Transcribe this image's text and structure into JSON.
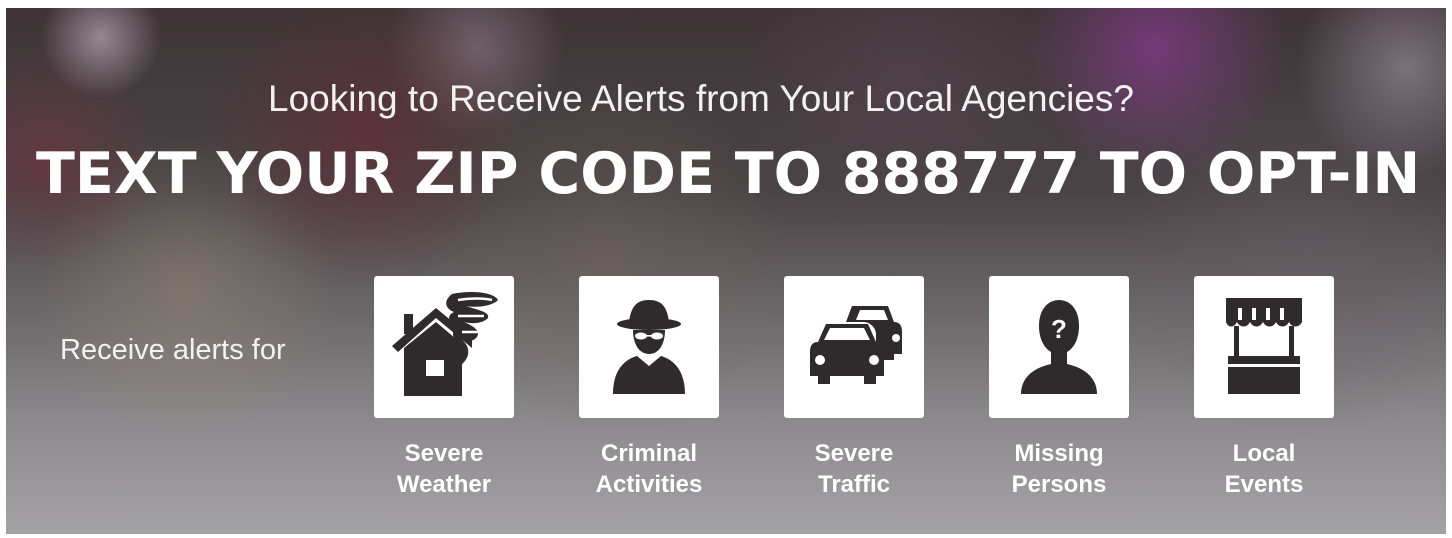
{
  "banner": {
    "subtitle": "Looking to Receive Alerts from Your Local Agencies?",
    "headline": "TEXT YOUR ZIP CODE TO 888777 TO OPT-IN",
    "receive_label": "Receive alerts for"
  },
  "alerts": [
    {
      "icon": "tornado-house-icon",
      "line1": "Severe",
      "line2": "Weather"
    },
    {
      "icon": "spy-icon",
      "line1": "Criminal",
      "line2": "Activities"
    },
    {
      "icon": "traffic-cars-icon",
      "line1": "Severe",
      "line2": "Traffic"
    },
    {
      "icon": "missing-person-icon",
      "line1": "Missing",
      "line2": "Persons"
    },
    {
      "icon": "market-stall-icon",
      "line1": "Local",
      "line2": "Events"
    }
  ],
  "colors": {
    "tile_background": "#ffffff",
    "icon_fill": "#2f2b2c",
    "text": "#ffffff"
  }
}
